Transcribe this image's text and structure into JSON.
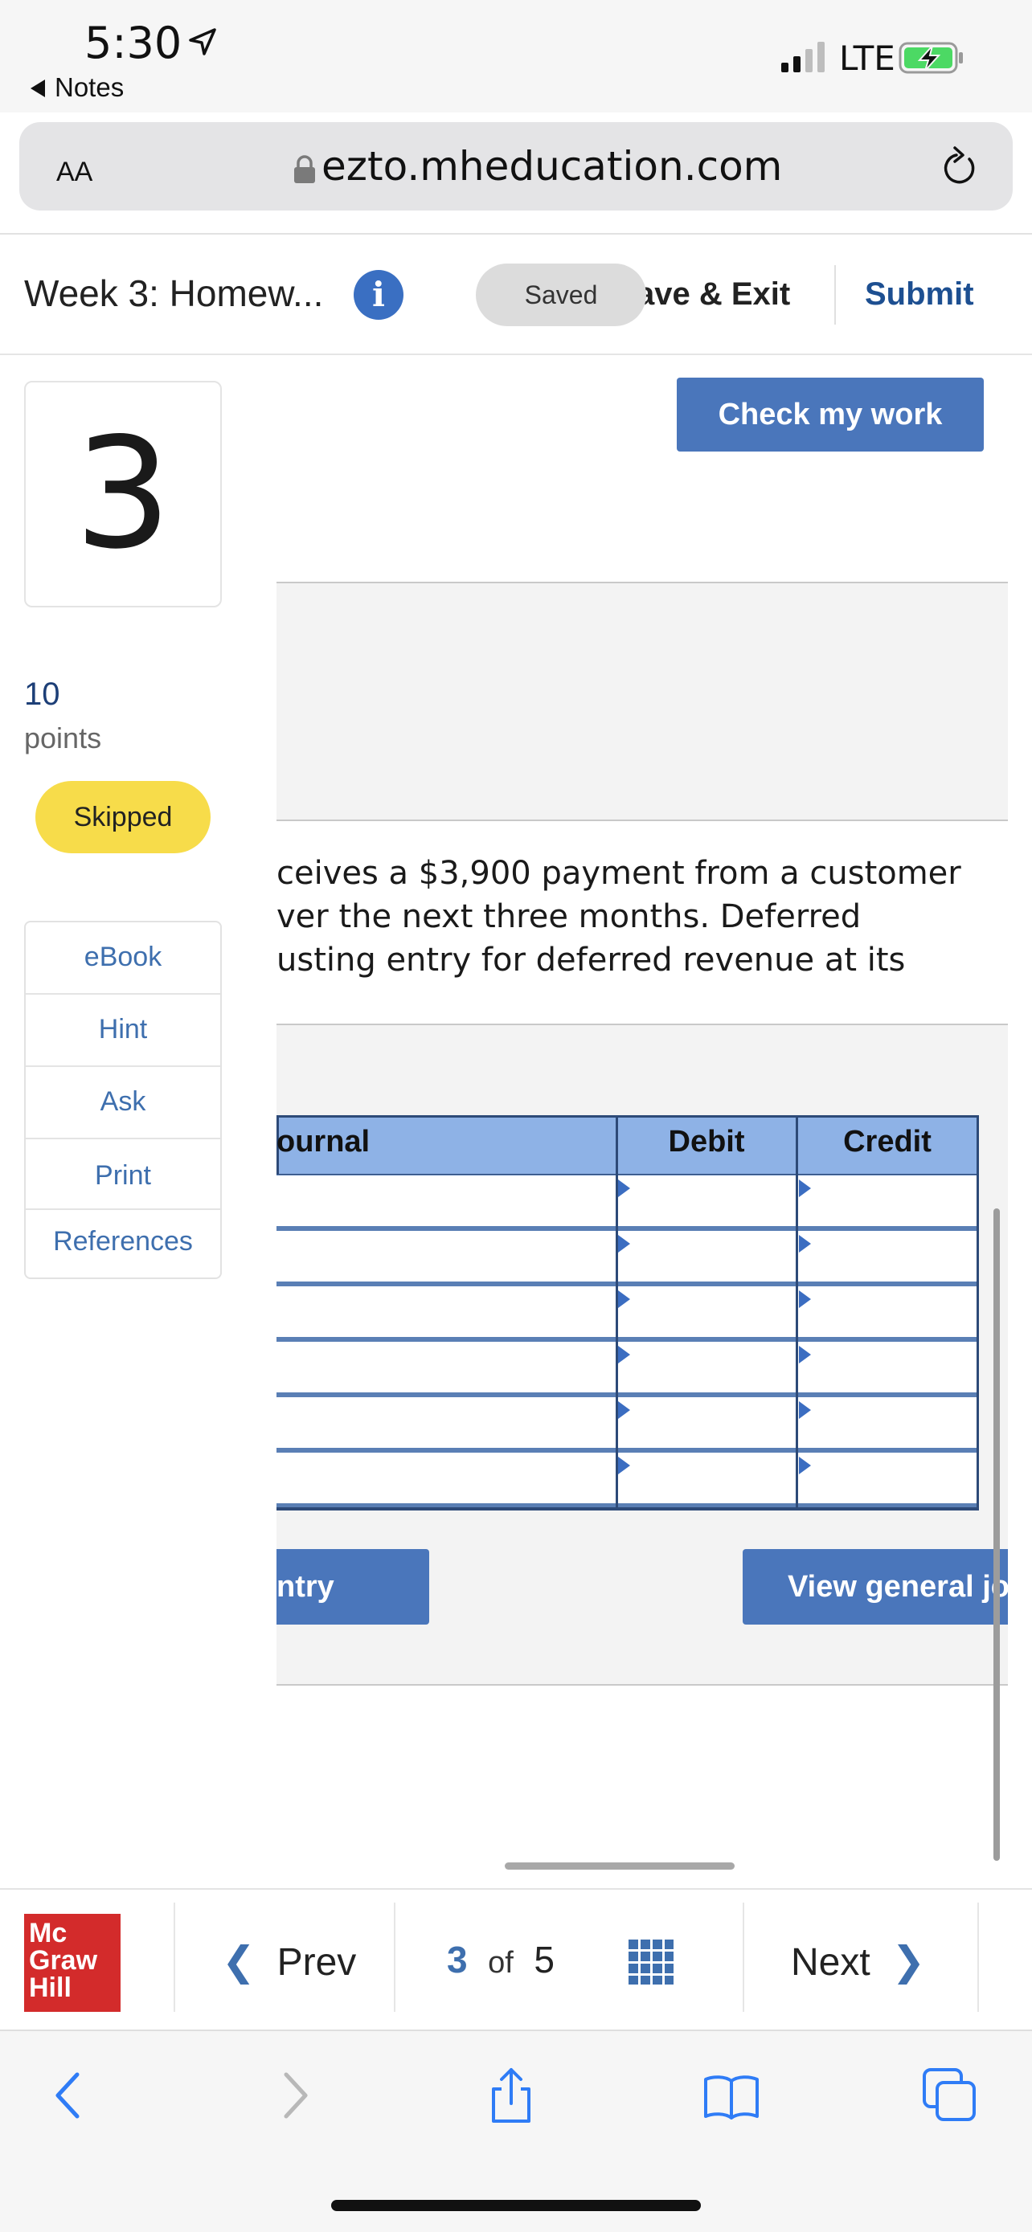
{
  "status_bar": {
    "time": "5:30",
    "back_app": "Notes",
    "network": "LTE"
  },
  "browser": {
    "text_size_label": "AA",
    "url": "ezto.mheducation.com"
  },
  "header": {
    "title": "Week 3: Homew...",
    "info_glyph": "i",
    "saved_label": "Saved",
    "save_exit_label": "ave & Exit",
    "submit_label": "Submit"
  },
  "question": {
    "number": "3",
    "points_value": "10",
    "points_label": "points",
    "status": "Skipped",
    "check_button": "Check my work",
    "text_lines": [
      "ceives a $3,900 payment from a customer",
      "ver the next three months. Deferred",
      "usting entry for deferred revenue at its"
    ]
  },
  "tools": [
    "eBook",
    "Hint",
    "Ask",
    "Print",
    "References"
  ],
  "journal": {
    "columns": [
      "ournal",
      "Debit",
      "Credit"
    ],
    "rows": 6,
    "entry_button": "ntry",
    "view_button": "View general jo"
  },
  "footer": {
    "logo_lines": [
      "Mc",
      "Graw",
      "Hill"
    ],
    "prev_label": "Prev",
    "current_page": "3",
    "of_label": "of",
    "total_pages": "5",
    "next_label": "Next"
  },
  "colors": {
    "brand_blue": "#4a76bb",
    "table_header": "#8eb2e6",
    "skipped_badge": "#f7dc4a",
    "logo_red": "#d32b2b"
  }
}
